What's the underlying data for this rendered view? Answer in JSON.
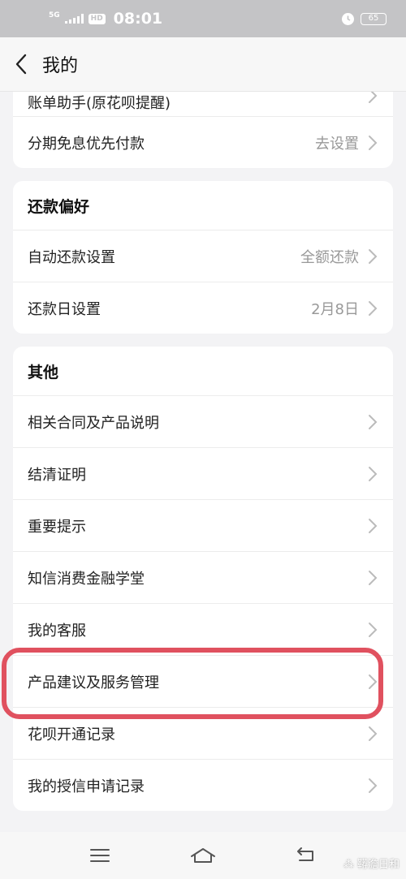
{
  "status_bar": {
    "network": "5G",
    "hd": "HD",
    "time": "08:01",
    "battery": "65"
  },
  "nav": {
    "title": "我的"
  },
  "card_top": {
    "partial_label": "账单助手(原花呗提醒)",
    "row": {
      "label": "分期免息优先付款",
      "value": "去设置"
    }
  },
  "repay_pref": {
    "title": "还款偏好",
    "rows": [
      {
        "label": "自动还款设置",
        "value": "全额还款"
      },
      {
        "label": "还款日设置",
        "value": "2月8日"
      }
    ]
  },
  "other": {
    "title": "其他",
    "rows": [
      {
        "label": "相关合同及产品说明"
      },
      {
        "label": "结清证明"
      },
      {
        "label": "重要提示"
      },
      {
        "label": "知信消费金融学堂"
      },
      {
        "label": "我的客服"
      },
      {
        "label": "产品建议及服务管理"
      },
      {
        "label": "花呗开通记录"
      },
      {
        "label": "我的授信申请记录"
      }
    ]
  },
  "highlight": {
    "color": "#e0515f"
  },
  "bottom_nav": {
    "icons": [
      "menu-icon",
      "home-icon",
      "back-icon"
    ]
  },
  "watermark": "⁂ 鞯澹日和"
}
